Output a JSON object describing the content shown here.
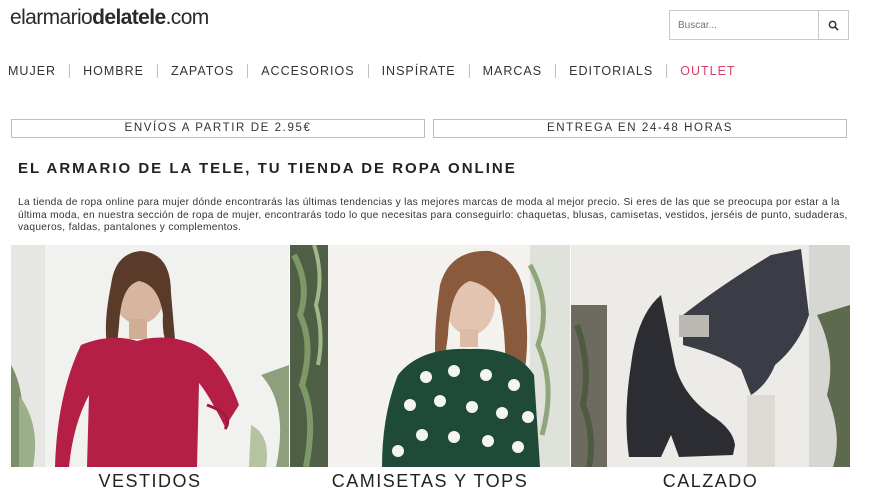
{
  "header": {
    "logo_prefix": "elarmario",
    "logo_bold": "delatele",
    "logo_suffix": ".com",
    "search_placeholder": "Buscar..."
  },
  "nav": {
    "items": [
      "MUJER",
      "HOMBRE",
      "ZAPATOS",
      "ACCESORIOS",
      "INSPÍRATE",
      "MARCAS",
      "EDITORIALS",
      "OUTLET"
    ],
    "accent_color": "#d8406a"
  },
  "banners": [
    "ENVÍOS A PARTIR DE 2.95€",
    "ENTREGA EN 24-48 HORAS"
  ],
  "main": {
    "heading": "EL ARMARIO DE LA TELE, TU TIENDA DE ROPA ONLINE",
    "description": "La tienda de ropa online para mujer dónde encontrarás las últimas tendencias y las mejores marcas de moda al mejor precio. Si eres de las que se preocupa por estar a la última moda, en nuestra sección de ropa de mujer, encontrarás todo lo que necesitas para conseguirlo: chaquetas, blusas, camisetas, vestidos, jerséis de punto, sudaderas, vaqueros, faldas, pantalones y complementos."
  },
  "categories": [
    "VESTIDOS",
    "CAMISETAS Y TOPS",
    "CALZADO"
  ]
}
